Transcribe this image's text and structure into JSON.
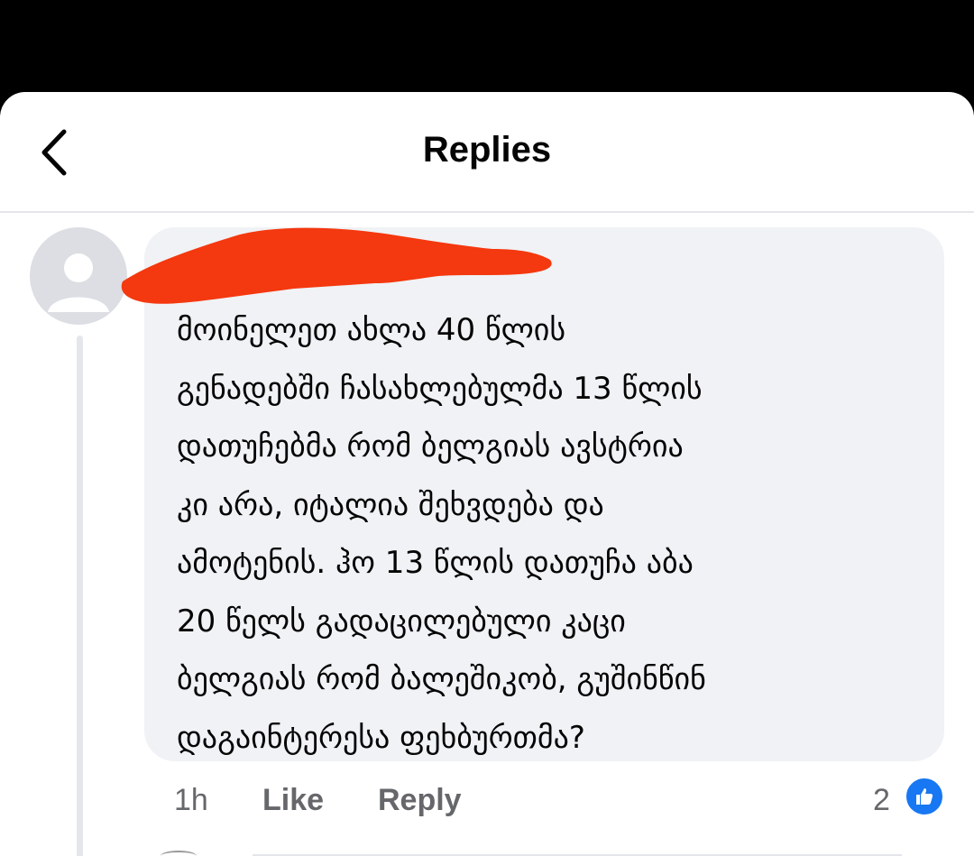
{
  "header": {
    "title": "Replies",
    "back_icon": "chevron-left-icon"
  },
  "comment": {
    "author": "",
    "author_redacted": true,
    "text": "მოინელეთ ახლა 40 წლის\nგენადებში ჩასახლებულმა 13 წლის\nდათუჩებმა რომ ბელგიას ავსტრია\nკი არა, იტალია შეხვდება და\nამოტენის. ჰო 13 წლის დათუჩა აბა\n20 წელს გადაცილებული კაცი\nბელგიას რომ ბალეშიკობ, გუშინწინ\nდაგაინტერესა ფეხბურთმა?",
    "time": "1h",
    "like_label": "Like",
    "reply_label": "Reply",
    "reaction_count": "2",
    "reaction_icon": "thumbs-up-icon"
  },
  "colors": {
    "bubble": "#f0f2f5",
    "reaction": "#1877f2",
    "redaction": "#f4380f",
    "secondary_text": "#65676b"
  }
}
